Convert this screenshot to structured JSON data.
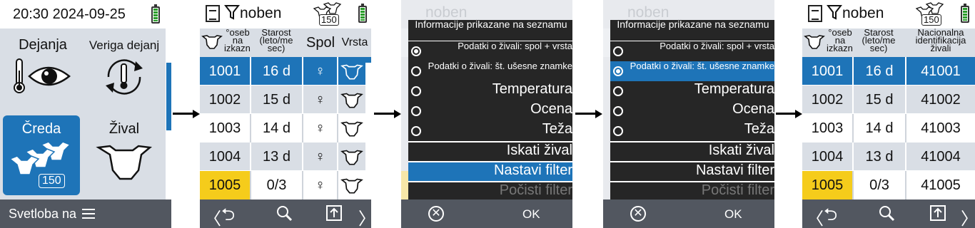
{
  "screen1": {
    "datetime": "20:30 2024-09-25",
    "tiles": [
      {
        "label": "Dejanja",
        "icon": "thermometer-eye-icon"
      },
      {
        "label": "Veriga dejanj",
        "icon": "cycle-thermometer-icon"
      },
      {
        "label": "Čreda",
        "icon": "herd-icon",
        "count": "150"
      },
      {
        "label": "Žival",
        "icon": "cow-head-icon"
      }
    ],
    "footer_label": "Svetloba na"
  },
  "list_screen": {
    "filter_label": "noben",
    "herd_count": "150",
    "headers": [
      "osebna izkazn.",
      "Starost (leto/mesec)",
      "Spol",
      "Vrsta"
    ],
    "headers_display": [
      "°oseb\nna\nizkazn.",
      "Starost\n(leto/me\nsec)",
      "Spol",
      "Vrsta"
    ],
    "rows": [
      {
        "id": "1001",
        "age": "16 d",
        "sex": "♀"
      },
      {
        "id": "1002",
        "age": "15 d",
        "sex": "♀"
      },
      {
        "id": "1003",
        "age": "14 d",
        "sex": "♀"
      },
      {
        "id": "1004",
        "age": "13 d",
        "sex": "♀"
      },
      {
        "id": "1005",
        "age": "0/3",
        "sex": "♀"
      }
    ]
  },
  "menu": {
    "title": "Informacije prikazane na seznamu",
    "options": [
      "Podatki o živali: spol + vrsta",
      "Podatki o živali: št. ušesne znamke",
      "Temperatura",
      "Ocena",
      "Teža"
    ],
    "actions": [
      "Iskati žival",
      "Nastavi filter",
      "Počisti filter"
    ],
    "ok_label": "OK"
  },
  "result_screen": {
    "filter_label": "noben",
    "herd_count": "150",
    "headers_display": [
      "°oseb\nna\nizkazn.",
      "Starost\n(leto/me\nsec)",
      "Nacionalna\nidentifikacija\nživali"
    ],
    "rows": [
      {
        "id": "1001",
        "age": "16 d",
        "nat_id": "41001"
      },
      {
        "id": "1002",
        "age": "15 d",
        "nat_id": "41002"
      },
      {
        "id": "1003",
        "age": "14 d",
        "nat_id": "41003"
      },
      {
        "id": "1004",
        "age": "13 d",
        "nat_id": "41004"
      },
      {
        "id": "1005",
        "age": "0/3",
        "nat_id": "41005"
      }
    ]
  },
  "colors": {
    "accent": "#1e74b8",
    "highlight": "#f5cc1b",
    "panel": "#d9dee5",
    "bar": "#525760"
  }
}
